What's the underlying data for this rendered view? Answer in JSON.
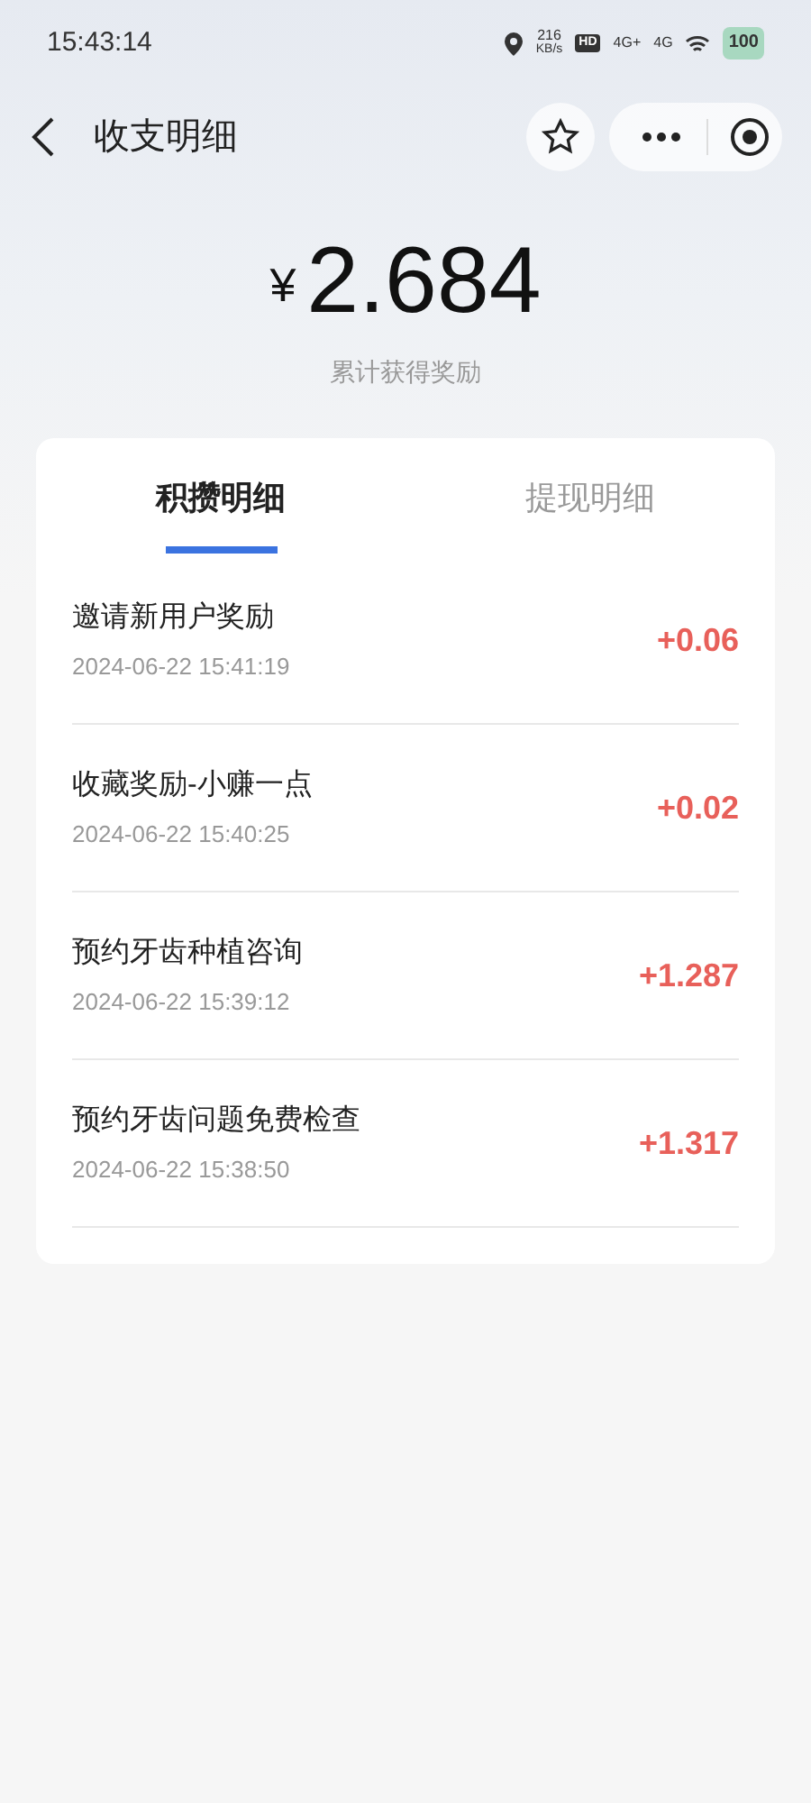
{
  "status_bar": {
    "time": "15:43:14",
    "speed": "216",
    "speed_unit": "KB/s",
    "hd": "HD",
    "network_1": "4G+",
    "network_2": "4G",
    "battery": "100"
  },
  "header": {
    "title": "收支明细"
  },
  "summary": {
    "currency": "¥",
    "amount": "2.684",
    "caption": "累计获得奖励"
  },
  "tabs": [
    {
      "label": "积攒明细",
      "selected": true
    },
    {
      "label": "提现明细",
      "selected": false
    }
  ],
  "records": [
    {
      "title": "邀请新用户奖励",
      "time": "2024-06-22 15:41:19",
      "amount": "+0.06"
    },
    {
      "title": "收藏奖励-小赚一点",
      "time": "2024-06-22 15:40:25",
      "amount": "+0.02"
    },
    {
      "title": "预约牙齿种植咨询",
      "time": "2024-06-22 15:39:12",
      "amount": "+1.287"
    },
    {
      "title": "预约牙齿问题免费检查",
      "time": "2024-06-22 15:38:50",
      "amount": "+1.317"
    }
  ]
}
